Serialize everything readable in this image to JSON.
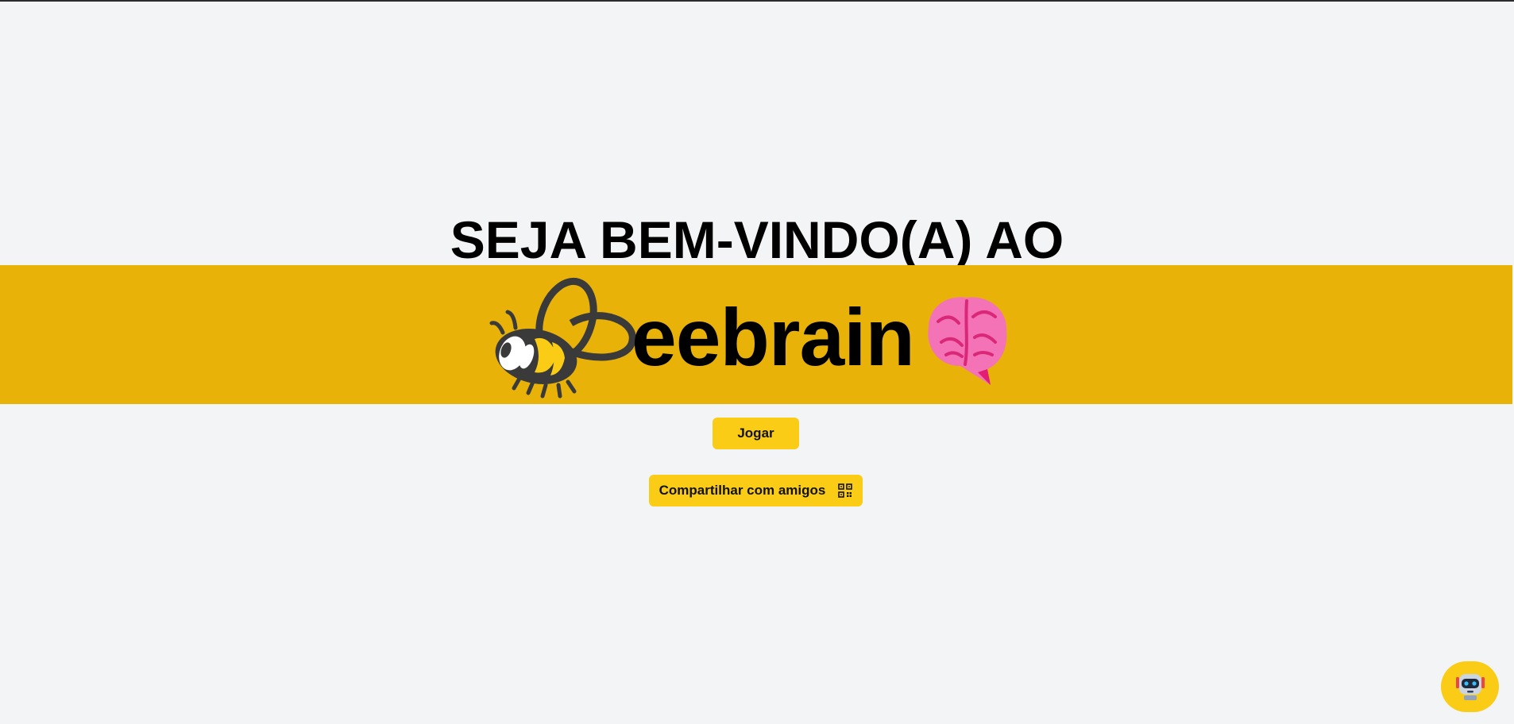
{
  "hero": {
    "welcome": "SEJA BEM-VINDO(A) AO",
    "brand_word": "eebrain"
  },
  "actions": {
    "play_label": "Jogar",
    "share_label": "Compartilhar com amigos"
  },
  "icons": {
    "bee": "bee-logo-icon",
    "brain": "brain-icon",
    "share": "qr-code-icon",
    "assistant": "robot-icon"
  },
  "colors": {
    "background": "#f3f4f6",
    "banner": "#e8b208",
    "button": "#facc15",
    "brain": "#f472b6",
    "text": "#000000"
  }
}
